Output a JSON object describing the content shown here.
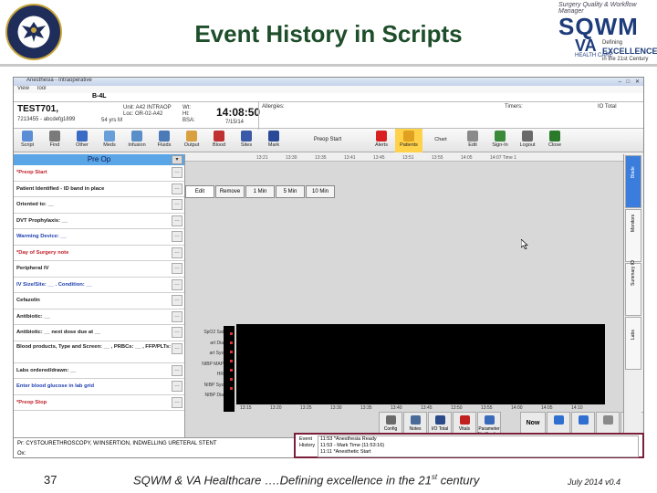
{
  "slide": {
    "title": "Event History in Scripts",
    "page_number": "37",
    "footer_text": "SQWM & VA Healthcare ….Defining excellence in the 21",
    "footer_sup": "st",
    "footer_tail": " century",
    "date_version": "July 2014  v0.4"
  },
  "logo": {
    "tagline": "Surgery Quality & Workflow Manager",
    "name": "SQWM",
    "va": "VA",
    "care": "HEALTH CARE",
    "sub1": "Defining",
    "sub2": "EXCELLENCE",
    "sub3": "in the 21st Century"
  },
  "app": {
    "window_title": "Anesthesia - Intraoperative",
    "window_controls": "– □ ✕",
    "menu": [
      "View",
      "Tool"
    ],
    "bed": "B-4L",
    "patient": {
      "name": "TEST701,",
      "info": "7213455 - abcdefg1899",
      "unit_label": "Unit:  A42 INTRAOP",
      "unit_value": "Loc:  OR-02-A42",
      "age": "54 yrs   M",
      "wt": "Wt:",
      "ht": "Ht:",
      "bsa": "BSA:",
      "clock": "14:08:50",
      "date": "7/15/14",
      "allergies": "Allergies:",
      "timers": "Timers:",
      "io_total": "IO Total"
    },
    "toolbar": [
      {
        "label": "Script",
        "color": "#5b8dd6"
      },
      {
        "label": "Find",
        "color": "#7a7a7a"
      },
      {
        "label": "Other",
        "color": "#3a6cc6"
      },
      {
        "label": "Meds",
        "color": "#6a9ed8"
      },
      {
        "label": "Infusion",
        "color": "#5a8ec8"
      },
      {
        "label": "Fluids",
        "color": "#4a7ab8"
      },
      {
        "label": "Output",
        "color": "#d8a040"
      },
      {
        "label": "Blood",
        "color": "#c03030"
      },
      {
        "label": "Sites",
        "color": "#3a5aa8"
      },
      {
        "label": "Mark",
        "color": "#2a4a98"
      },
      {
        "label": "Preop Start",
        "wide": true
      },
      {
        "label": "Alerts",
        "color": "#d82020"
      },
      {
        "label": "Patients",
        "color": "#e0a020",
        "active": true
      },
      {
        "label": "Chart",
        "wide2": true
      },
      {
        "label": "Edit",
        "color": "#8a8a8a"
      },
      {
        "label": "Sign-In",
        "color": "#3a8a3a"
      },
      {
        "label": "Logout",
        "color": "#6a6a6a"
      },
      {
        "label": "Close",
        "color": "#2a7a2a"
      }
    ],
    "script_header": "Pre Op",
    "script_rows": [
      {
        "text": "*Preop Start",
        "color": "red"
      },
      {
        "text": "Patient Identified - ID band in place",
        "color": "blk"
      },
      {
        "text": "Oriented to:  __",
        "color": "blk"
      },
      {
        "text": "DVT Prophylaxis:  __",
        "color": "blk"
      },
      {
        "text": "Warming Device:  __",
        "color": "blue"
      },
      {
        "text": "*Day of Surgery note",
        "color": "red"
      },
      {
        "text": "Peripheral IV",
        "color": "blk"
      },
      {
        "text": "IV Size/Site:  __ .  Condition:  __",
        "color": "blue"
      },
      {
        "text": "Cefazolin",
        "color": "blk"
      },
      {
        "text": "Antibiotic:  __",
        "color": "blk"
      },
      {
        "text": "Antibiotic:  __   next dose due at  __",
        "color": "blk"
      },
      {
        "text": "Blood products, Type and Screen:  __ , PRBCs:  __ , FFP/PLTs:  __",
        "color": "blk",
        "tall": true
      },
      {
        "text": "Labs ordered/drawn:  __",
        "color": "blk"
      },
      {
        "text": "Enter blood glucose in lab grid",
        "color": "blue"
      },
      {
        "text": "*Preop Stop",
        "color": "red"
      }
    ],
    "time_axis": [
      "13:21",
      "13:30",
      "13:35",
      "13:41",
      "13:45",
      "13:51",
      "13:55",
      "14:05",
      "14:07 Time 1"
    ],
    "event_buttons": [
      "Edit",
      "Remove",
      "1 Min",
      "5 Min",
      "10 Min"
    ],
    "vitals_labels": [
      "SpO2 Sat",
      "art Dia",
      "art Sys",
      "NIBP MAP",
      "HR",
      "NIBP Sys",
      "NIBP Dia"
    ],
    "graph_scale": [
      "300",
      "250",
      "200",
      "150",
      "100",
      "50",
      "0"
    ],
    "graph_tics": [
      "13:15",
      "13:20",
      "13:25",
      "13:30",
      "13:35",
      "13:40",
      "13:45",
      "13:50",
      "13:55",
      "14:00",
      "14:05",
      "14:10"
    ],
    "bottom_buttons": [
      {
        "label": "Config",
        "color": "#6a6a6a"
      },
      {
        "label": "Notes",
        "color": "#4a6a9a"
      },
      {
        "label": "I/O Total",
        "color": "#2a4a8a"
      },
      {
        "label": "Vitals",
        "color": "#c02020"
      },
      {
        "label": "Parameter Notification",
        "color": "#3a6aba"
      }
    ],
    "now_label": "Now",
    "side_tabs": [
      "Blade",
      "Monitors",
      "Summary IO",
      "Labs"
    ],
    "procedure": "Pr:  CYSTOURETHROSCOPY, W/INSERTION, INDWELLING URETERAL STENT",
    "ox": "Ox:",
    "event_history": {
      "label1": "Event",
      "label2": "History",
      "items": [
        "11:53  *Anesthesia Ready",
        "11:53 - Mark Time (11:53:16)",
        "11:11  *Anesthetic Start"
      ]
    }
  }
}
